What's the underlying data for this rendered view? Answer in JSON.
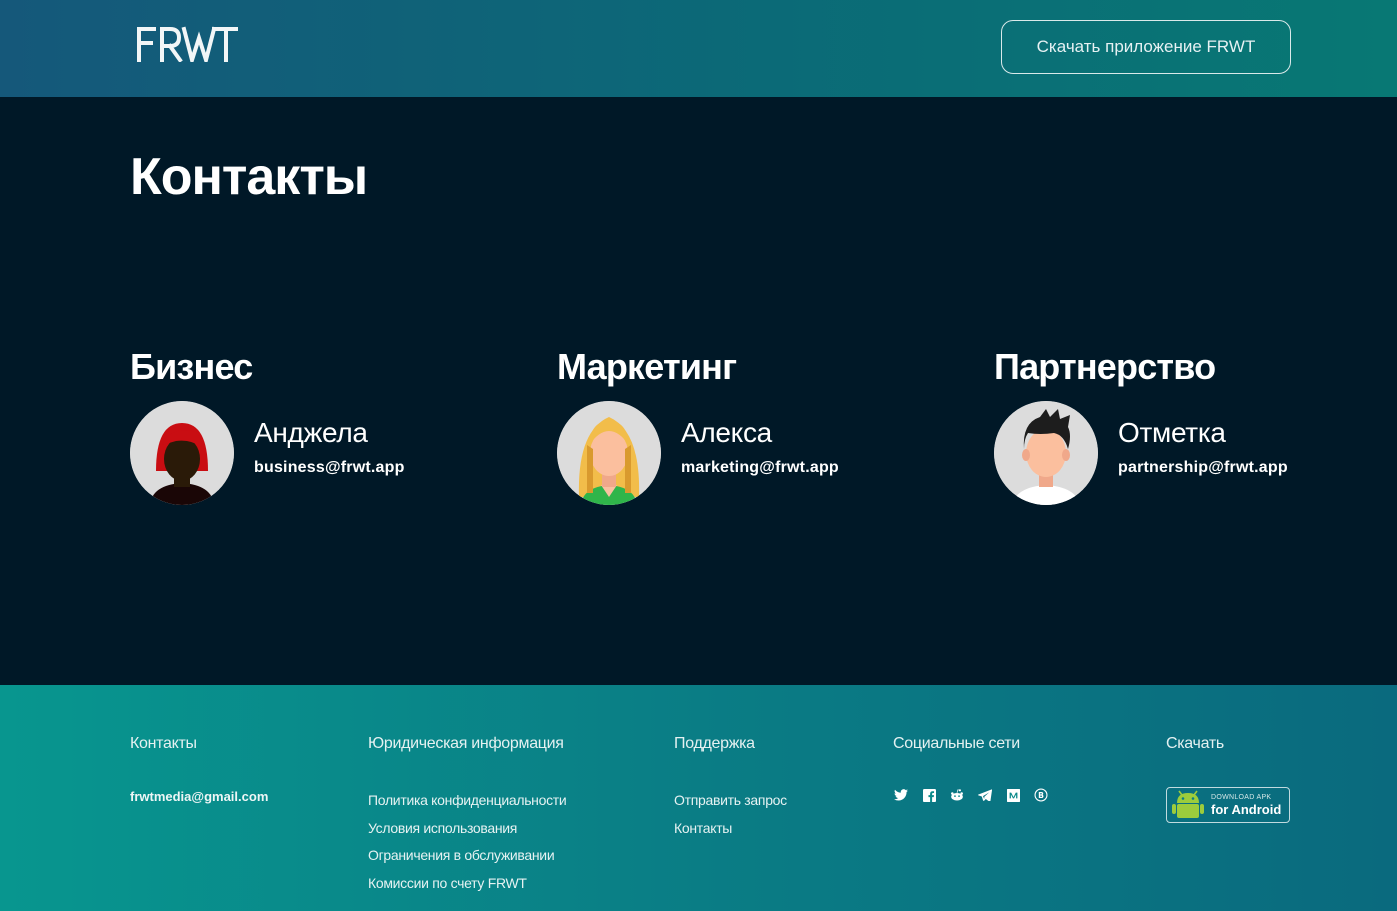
{
  "header": {
    "logo_text": "FRWT",
    "download_button": "Скачать приложение FRWT"
  },
  "main": {
    "title": "Контакты",
    "contacts": [
      {
        "section": "Бизнес",
        "name": "Анджела",
        "email": "business@frwt.app",
        "avatar": "woman-red-hair-avatar"
      },
      {
        "section": "Маркетинг",
        "name": "Алекса",
        "email": "marketing@frwt.app",
        "avatar": "woman-blonde-avatar"
      },
      {
        "section": "Партнерство",
        "name": "Отметка",
        "email": "partnership@frwt.app",
        "avatar": "man-dark-hair-avatar"
      }
    ]
  },
  "footer": {
    "contacts": {
      "heading": "Контакты",
      "email": "frwtmedia@gmail.com"
    },
    "legal": {
      "heading": "Юридическая информация",
      "links": [
        "Политика конфиденциальности",
        "Условия использования",
        "Ограничения в обслуживании",
        "Комиссии по счету FRWT"
      ]
    },
    "support": {
      "heading": "Поддержка",
      "links": [
        "Отправить запрос",
        "Контакты"
      ]
    },
    "social": {
      "heading": "Социальные сети",
      "icons": [
        "twitter-icon",
        "facebook-icon",
        "reddit-icon",
        "telegram-icon",
        "medium-icon",
        "bitcoin-icon"
      ]
    },
    "download": {
      "heading": "Скачать",
      "apk_small": "DOWNLOAD APK",
      "apk_big": "for Android"
    }
  },
  "colors": {
    "background": "#001827",
    "header_gradient_start": "#15587a",
    "header_gradient_end": "#087874",
    "footer_gradient_start": "#08968f",
    "footer_gradient_end": "#0a6a7e"
  }
}
